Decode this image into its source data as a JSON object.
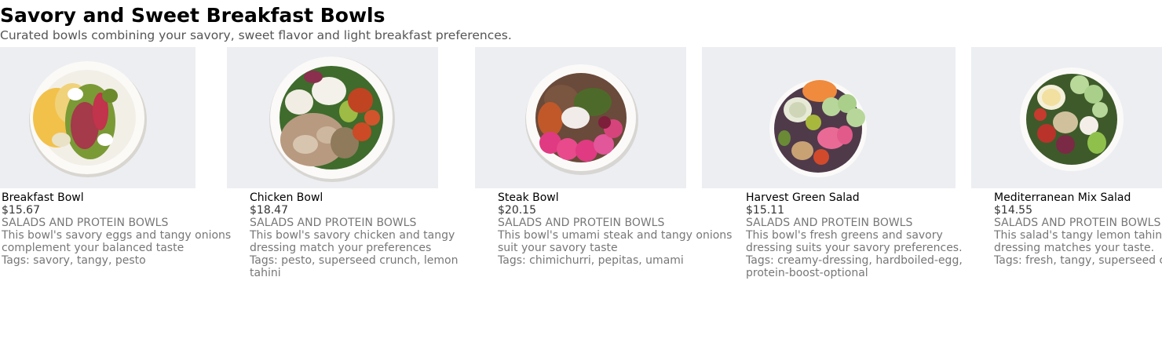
{
  "header": {
    "title": "Savory and Sweet Breakfast Bowls",
    "subtitle": "Curated bowls combining your savory, sweet flavor and light breakfast preferences."
  },
  "items": [
    {
      "name": "Breakfast Bowl",
      "price": "$15.67",
      "category": "SALADS AND PROTEIN BOWLS",
      "description": "This bowl's savory eggs and tangy onions complement your balanced taste",
      "tags": "Tags: savory, tangy, pesto"
    },
    {
      "name": "Chicken Bowl",
      "price": "$18.47",
      "category": "SALADS AND PROTEIN BOWLS",
      "description": "This bowl's savory chicken and tangy dressing match your preferences",
      "tags": "Tags: pesto, superseed crunch, lemon tahini"
    },
    {
      "name": "Steak Bowl",
      "price": "$20.15",
      "category": "SALADS AND PROTEIN BOWLS",
      "description": "This bowl's umami steak and tangy onions suit your savory taste",
      "tags": "Tags: chimichurri, pepitas, umami"
    },
    {
      "name": "Harvest Green Salad",
      "price": "$15.11",
      "category": "SALADS AND PROTEIN BOWLS",
      "description": "This bowl's fresh greens and savory dressing suits your savory preferences.",
      "tags": "Tags: creamy-dressing, hardboiled-egg, protein-boost-optional"
    },
    {
      "name": "Mediterranean Mix Salad",
      "price": "$14.55",
      "category": "SALADS AND PROTEIN BOWLS",
      "description": "This salad's tangy lemon tahini dressing matches your taste.",
      "tags": "Tags: fresh, tangy, superseed crunch"
    }
  ]
}
